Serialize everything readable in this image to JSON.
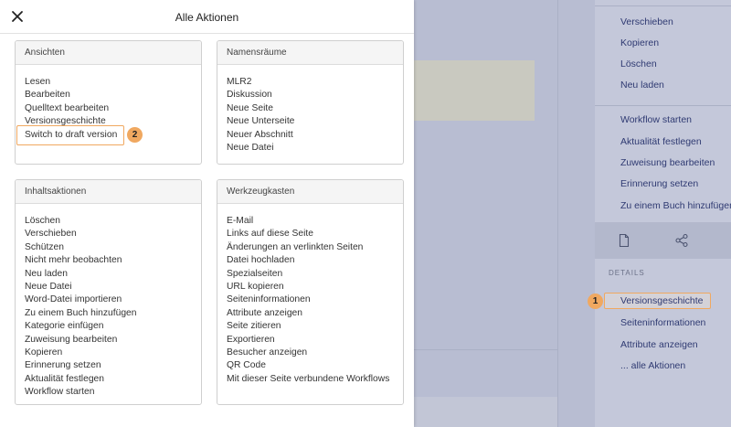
{
  "modal": {
    "title": "Alle Aktionen",
    "panels": {
      "ansichten": {
        "header": "Ansichten",
        "items": [
          "Lesen",
          "Bearbeiten",
          "Quelltext bearbeiten",
          "Versionsgeschichte",
          "Switch to draft version"
        ]
      },
      "namensraeume": {
        "header": "Namensräume",
        "items": [
          "MLR2",
          "Diskussion",
          "Neue Seite",
          "Neue Unterseite",
          "Neuer Abschnitt",
          "Neue Datei"
        ]
      },
      "inhaltsaktionen": {
        "header": "Inhaltsaktionen",
        "items": [
          "Löschen",
          "Verschieben",
          "Schützen",
          "Nicht mehr beobachten",
          "Neu laden",
          "Neue Datei",
          "Word-Datei importieren",
          "Zu einem Buch hinzufügen",
          "Kategorie einfügen",
          "Zuweisung bearbeiten",
          "Kopieren",
          "Erinnerung setzen",
          "Aktualität festlegen",
          "Workflow starten"
        ]
      },
      "werkzeugkasten": {
        "header": "Werkzeugkasten",
        "items": [
          "E-Mail",
          "Links auf diese Seite",
          "Änderungen an verlinkten Seiten",
          "Datei hochladen",
          "Spezialseiten",
          "URL kopieren",
          "Seiteninformationen",
          "Attribute anzeigen",
          "Seite zitieren",
          "Exportieren",
          "Besucher anzeigen",
          "QR Code",
          "Mit dieser Seite verbundene Workflows"
        ]
      }
    }
  },
  "sidebar": {
    "group1": [
      "Verschieben",
      "Kopieren",
      "Löschen",
      "Neu laden"
    ],
    "group2": [
      "Workflow starten",
      "Aktualität festlegen",
      "Zuweisung bearbeiten",
      "Erinnerung setzen",
      "Zu einem Buch hinzufügen"
    ],
    "details_heading": "DETAILS",
    "details": [
      "Versionsgeschichte",
      "Seiteninformationen",
      "Attribute anzeigen",
      "... alle Aktionen"
    ]
  },
  "badges": {
    "first": "1",
    "second": "2"
  },
  "icons": {
    "close": "close-icon",
    "page": "page-icon",
    "share": "share-icon"
  },
  "colors": {
    "highlight": "#f0a860",
    "link": "#2f3a72",
    "overlay": "#b8bdd2"
  }
}
